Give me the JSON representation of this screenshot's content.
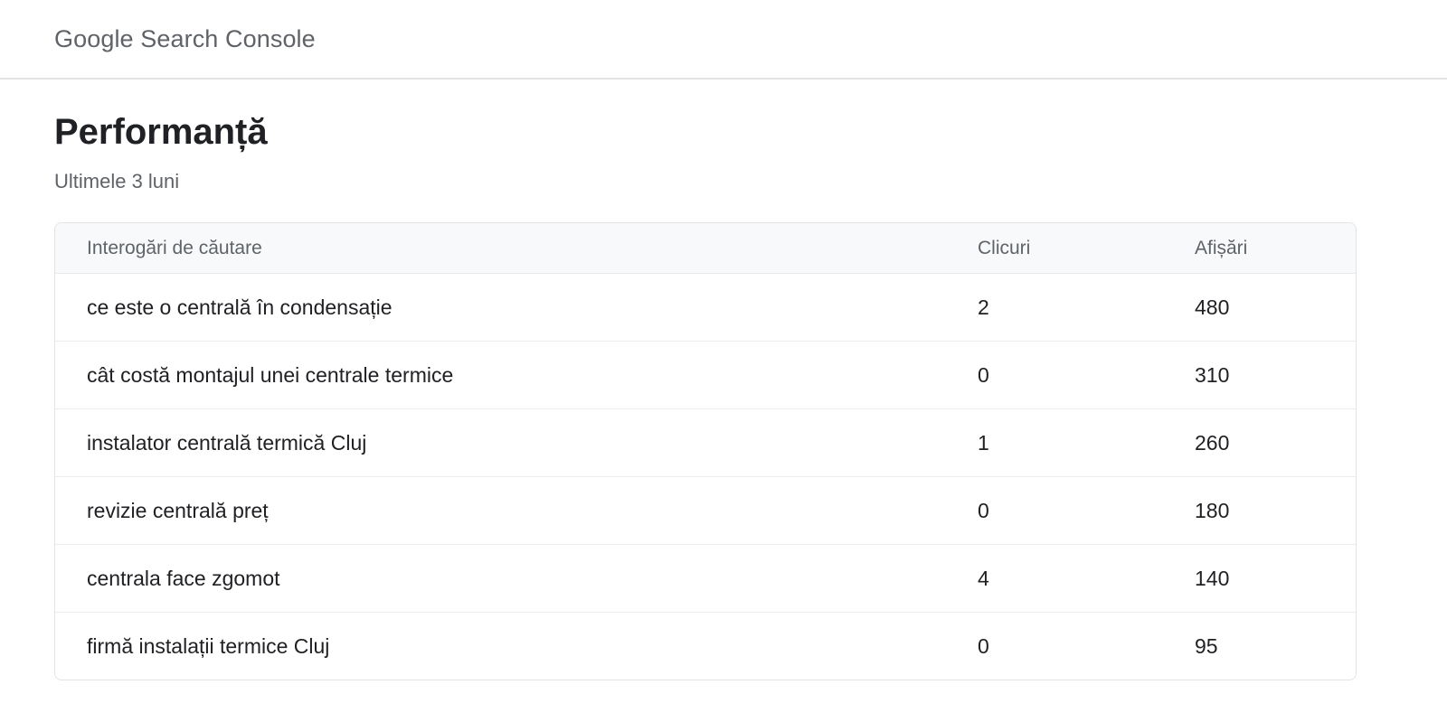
{
  "header": {
    "app_title": "Google Search Console"
  },
  "main": {
    "title": "Performanță",
    "subtitle": "Ultimele 3 luni"
  },
  "table": {
    "columns": {
      "query": "Interogări de căutare",
      "clicks": "Clicuri",
      "impressions": "Afișări"
    },
    "rows": [
      {
        "query": "ce este o centrală în condensație",
        "clicks": "2",
        "impressions": "480"
      },
      {
        "query": "cât costă montajul unei centrale termice",
        "clicks": "0",
        "impressions": "310"
      },
      {
        "query": "instalator centrală termică Cluj",
        "clicks": "1",
        "impressions": "260"
      },
      {
        "query": "revizie centrală preț",
        "clicks": "0",
        "impressions": "180"
      },
      {
        "query": "centrala face zgomot",
        "clicks": "4",
        "impressions": "140"
      },
      {
        "query": "firmă instalații termice Cluj",
        "clicks": "0",
        "impressions": "95"
      }
    ]
  }
}
